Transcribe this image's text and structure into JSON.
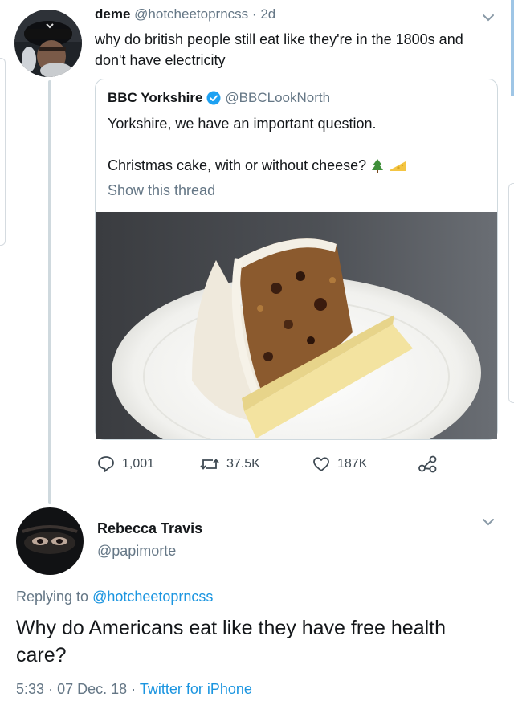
{
  "tweet": {
    "author_name": "deme",
    "author_handle": "@hotcheetoprncss",
    "separator": "·",
    "age": "2d",
    "text": "why do british people still eat like they're in the 1800s and don't have electricity"
  },
  "quoted": {
    "author_name": "BBC Yorkshire",
    "author_handle": "@BBCLookNorth",
    "line1": "Yorkshire, we have an important question.",
    "line2": "Christmas cake, with or without cheese?",
    "show_thread": "Show this thread"
  },
  "actions": {
    "replies": "1,001",
    "retweets": "37.5K",
    "likes": "187K"
  },
  "reply": {
    "author_name": "Rebecca Travis",
    "author_handle": "@papimorte",
    "replying_to_prefix": "Replying to",
    "replying_to_handle": "@hotcheetoprncss",
    "text": "Why do Americans eat like they have free health care?",
    "time": "5:33",
    "sep1": "·",
    "date": "07 Dec. 18",
    "sep2": "·",
    "client": "Twitter for iPhone"
  },
  "colors": {
    "link": "#1b95e0",
    "muted": "#657786",
    "verified": "#1da1f2",
    "border": "#cfd9de"
  },
  "icons": [
    "verified-badge-icon",
    "tree-emoji-icon",
    "cheese-emoji-icon",
    "reply-icon",
    "retweet-icon",
    "like-icon",
    "share-icon",
    "chevron-down-icon"
  ]
}
